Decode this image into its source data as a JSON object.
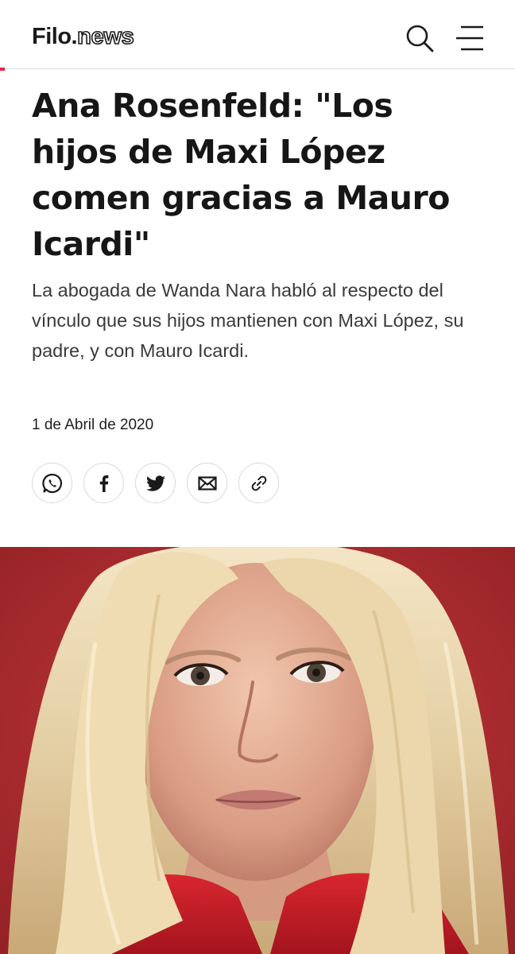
{
  "header": {
    "logo_main": "Filo.",
    "logo_sub": "news",
    "search_icon": "search-icon",
    "menu_icon": "hamburger-menu-icon"
  },
  "article": {
    "title": "Ana Rosenfeld: \"Los hijos de Maxi López comen gracias a Mauro Icardi\"",
    "subtitle": "La abogada de Wanda Nara habló al respecto del vínculo que sus hijos mantienen con Maxi López, su padre, y con Mauro Icardi.",
    "date": "1 de Abril de 2020"
  },
  "share": {
    "buttons": [
      "whatsapp-icon",
      "facebook-icon",
      "twitter-icon",
      "email-icon",
      "link-icon"
    ]
  },
  "hero": {
    "image": "portrait-photo"
  },
  "colors": {
    "accent": "#e8254f",
    "text": "#161616",
    "subtitle": "#3a3a3a",
    "photo_background": "#b42a2e"
  }
}
